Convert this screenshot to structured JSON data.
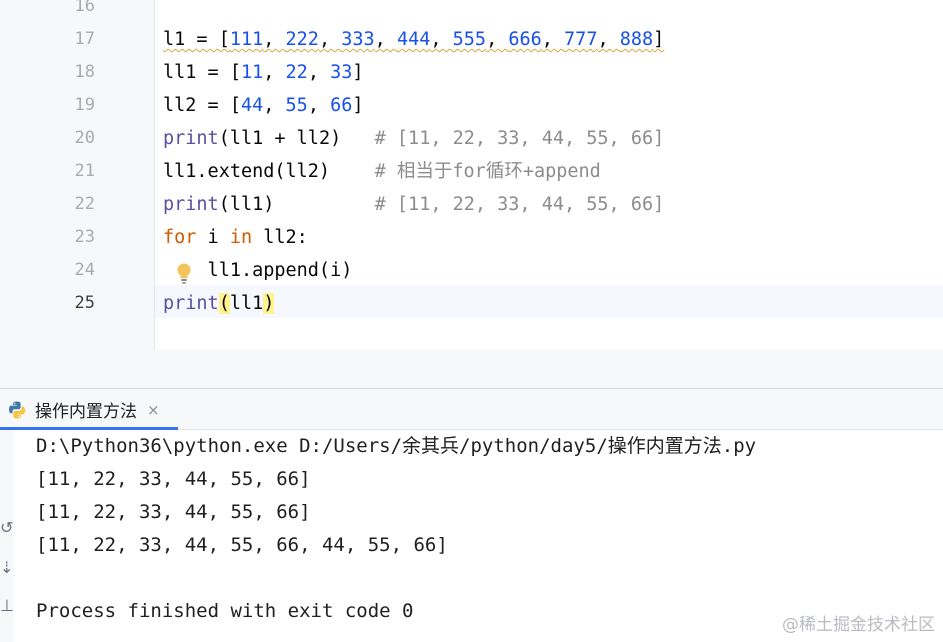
{
  "editor": {
    "lines": [
      {
        "num": "16",
        "tokens": []
      },
      {
        "num": "17",
        "tokens": [
          {
            "t": "l1 = [",
            "c": ""
          },
          {
            "t": "111",
            "c": "c-num"
          },
          {
            "t": ", ",
            "c": ""
          },
          {
            "t": "222",
            "c": "c-num"
          },
          {
            "t": ", ",
            "c": ""
          },
          {
            "t": "333",
            "c": "c-num"
          },
          {
            "t": ", ",
            "c": ""
          },
          {
            "t": "444",
            "c": "c-num"
          },
          {
            "t": ", ",
            "c": ""
          },
          {
            "t": "555",
            "c": "c-num"
          },
          {
            "t": ", ",
            "c": ""
          },
          {
            "t": "666",
            "c": "c-num"
          },
          {
            "t": ", ",
            "c": ""
          },
          {
            "t": "777",
            "c": "c-num"
          },
          {
            "t": ", ",
            "c": ""
          },
          {
            "t": "888",
            "c": "c-num"
          },
          {
            "t": "]",
            "c": ""
          }
        ],
        "squiggle": true
      },
      {
        "num": "18",
        "tokens": [
          {
            "t": "ll1 = [",
            "c": ""
          },
          {
            "t": "11",
            "c": "c-num"
          },
          {
            "t": ", ",
            "c": ""
          },
          {
            "t": "22",
            "c": "c-num"
          },
          {
            "t": ", ",
            "c": ""
          },
          {
            "t": "33",
            "c": "c-num"
          },
          {
            "t": "]",
            "c": ""
          }
        ]
      },
      {
        "num": "19",
        "tokens": [
          {
            "t": "ll2 = [",
            "c": ""
          },
          {
            "t": "44",
            "c": "c-num"
          },
          {
            "t": ", ",
            "c": ""
          },
          {
            "t": "55",
            "c": "c-num"
          },
          {
            "t": ", ",
            "c": ""
          },
          {
            "t": "66",
            "c": "c-num"
          },
          {
            "t": "]",
            "c": ""
          }
        ]
      },
      {
        "num": "20",
        "tokens": [
          {
            "t": "print",
            "c": "c-builtin"
          },
          {
            "t": "(ll1 + ll2)   ",
            "c": ""
          },
          {
            "t": "# [11, 22, 33, 44, 55, 66]",
            "c": "c-comment"
          }
        ]
      },
      {
        "num": "21",
        "tokens": [
          {
            "t": "ll1.extend(ll2)    ",
            "c": ""
          },
          {
            "t": "# 相当于for循环+append",
            "c": "c-comment"
          }
        ]
      },
      {
        "num": "22",
        "tokens": [
          {
            "t": "print",
            "c": "c-builtin"
          },
          {
            "t": "(ll1)         ",
            "c": ""
          },
          {
            "t": "# [11, 22, 33, 44, 55, 66]",
            "c": "c-comment"
          }
        ]
      },
      {
        "num": "23",
        "tokens": [
          {
            "t": "for",
            "c": "c-kw"
          },
          {
            "t": " i ",
            "c": ""
          },
          {
            "t": "in",
            "c": "c-kw"
          },
          {
            "t": " ll2:",
            "c": ""
          }
        ]
      },
      {
        "num": "24",
        "tokens": [
          {
            "t": "    ll1.append(i)",
            "c": ""
          }
        ]
      },
      {
        "num": "25",
        "tokens": [
          {
            "t": "print",
            "c": "c-builtin"
          },
          {
            "t": "(",
            "c": "c-paren"
          },
          {
            "t": "ll1",
            "c": ""
          },
          {
            "t": ")",
            "c": "c-paren"
          }
        ],
        "current": true
      }
    ],
    "intention_icon": "lightbulb-icon"
  },
  "run_panel": {
    "tab_label": "操作内置方法",
    "tab_icon": "python-icon",
    "close_icon": "close-icon",
    "close_glyph": "×",
    "output": [
      "D:\\Python36\\python.exe D:/Users/余其兵/python/day5/操作内置方法.py",
      "[11, 22, 33, 44, 55, 66]",
      "[11, 22, 33, 44, 55, 66]",
      "[11, 22, 33, 44, 55, 66, 44, 55, 66]",
      "",
      "Process finished with exit code 0"
    ]
  },
  "watermark": "@稀土掘金技术社区",
  "colors": {
    "accent": "#3574f0",
    "number": "#1750eb",
    "keyword": "#cf5b00",
    "builtin": "#5b4fa1",
    "comment": "#8c8c8c"
  }
}
